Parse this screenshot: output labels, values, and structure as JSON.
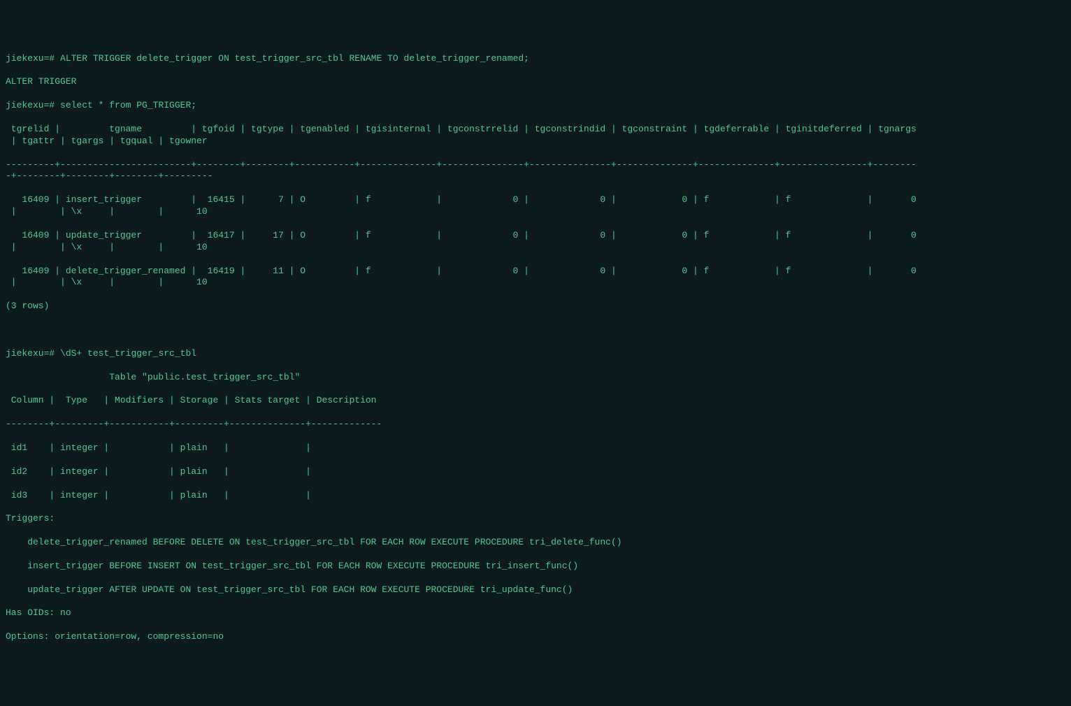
{
  "prompt": "jiekexu=#",
  "commands": {
    "alter": "ALTER TRIGGER delete_trigger ON test_trigger_src_tbl RENAME TO delete_trigger_renamed;",
    "alter_result": "ALTER TRIGGER",
    "select": "select * from PG_TRIGGER;",
    "describe": "\\dS+ test_trigger_src_tbl"
  },
  "pg_trigger_header": " tgrelid |         tgname         | tgfoid | tgtype | tgenabled | tgisinternal | tgconstrrelid | tgconstrindid | tgconstraint | tgdeferrable | tginitdeferred | tgnargs\n | tgattr | tgargs | tgqual | tgowner",
  "pg_trigger_sep1": "---------+------------------------+--------+--------+-----------+--------------+---------------+---------------+--------------+--------------+----------------+--------\n-+--------+--------+--------+---------",
  "pg_trigger_rows": [
    "   16409 | insert_trigger         |  16415 |      7 | O         | f            |             0 |             0 |            0 | f            | f              |       0\n |        | \\x     |        |      10",
    "   16409 | update_trigger         |  16417 |     17 | O         | f            |             0 |             0 |            0 | f            | f              |       0\n |        | \\x     |        |      10",
    "   16409 | delete_trigger_renamed |  16419 |     11 | O         | f            |             0 |             0 |            0 | f            | f              |       0\n |        | \\x     |        |      10"
  ],
  "row_count": "(3 rows)",
  "table_title": "                   Table \"public.test_trigger_src_tbl\"",
  "table_header": " Column |  Type   | Modifiers | Storage | Stats target | Description",
  "table_sep": "--------+---------+-----------+---------+--------------+-------------",
  "table_rows": [
    " id1    | integer |           | plain   |              |",
    " id2    | integer |           | plain   |              |",
    " id3    | integer |           | plain   |              |"
  ],
  "triggers_label": "Triggers:",
  "triggers": [
    "    delete_trigger_renamed BEFORE DELETE ON test_trigger_src_tbl FOR EACH ROW EXECUTE PROCEDURE tri_delete_func()",
    "    insert_trigger BEFORE INSERT ON test_trigger_src_tbl FOR EACH ROW EXECUTE PROCEDURE tri_insert_func()",
    "    update_trigger AFTER UPDATE ON test_trigger_src_tbl FOR EACH ROW EXECUTE PROCEDURE tri_update_func()"
  ],
  "has_oids": "Has OIDs: no",
  "options": "Options: orientation=row, compression=no"
}
